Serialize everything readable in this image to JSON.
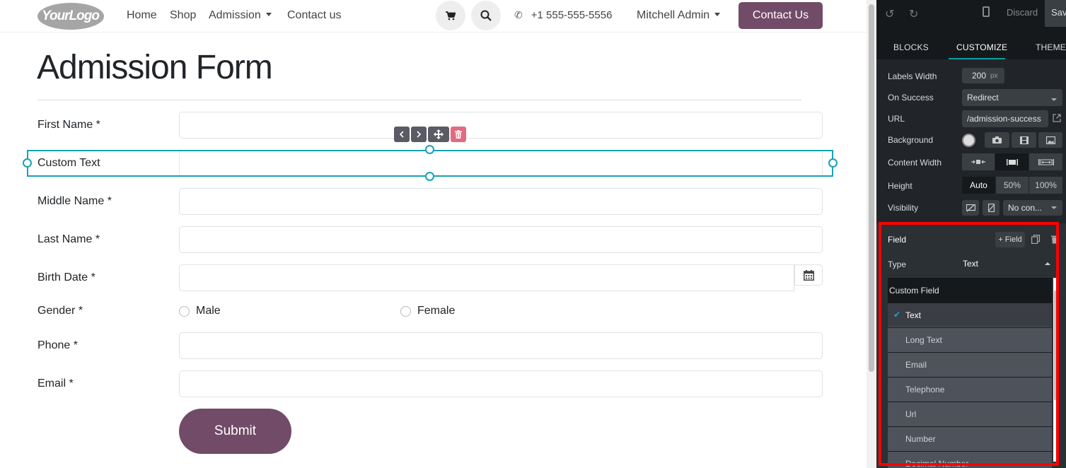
{
  "navbar": {
    "logo_text": "YourLogo",
    "links": [
      "Home",
      "Shop",
      "Admission",
      "Contact us"
    ],
    "cart_icon": "cart-icon",
    "search_icon": "search-icon",
    "phone": "+1 555-555-5556",
    "user": "Mitchell Admin",
    "cta": "Contact Us"
  },
  "form": {
    "title": "Admission Form",
    "fields": {
      "first_name": "First Name *",
      "custom_text": "Custom Text",
      "middle_name": "Middle Name *",
      "last_name": "Last Name *",
      "birth_date": "Birth Date *",
      "gender": "Gender *",
      "phone": "Phone *",
      "email": "Email *"
    },
    "gender_options": [
      "Male",
      "Female"
    ],
    "submit": "Submit"
  },
  "editor": {
    "discard": "Discard",
    "save": "Save",
    "tabs": [
      "BLOCKS",
      "CUSTOMIZE",
      "THEME"
    ],
    "active_tab": "CUSTOMIZE",
    "options": {
      "labels_width_label": "Labels Width",
      "labels_width_value": "200",
      "labels_width_unit": "px",
      "on_success_label": "On Success",
      "on_success_value": "Redirect",
      "url_label": "URL",
      "url_value": "/admission-success",
      "background_label": "Background",
      "content_width_label": "Content Width",
      "height_label": "Height",
      "height_options": [
        "Auto",
        "50%",
        "100%"
      ],
      "visibility_label": "Visibility",
      "visibility_value": "No con..."
    },
    "field": {
      "title": "Field",
      "add_button": "+ Field",
      "type_label": "Type",
      "type_value": "Text"
    },
    "dropdown": {
      "header": "Custom Field",
      "items": [
        "Text",
        "Long Text",
        "Email",
        "Telephone",
        "Url",
        "Number",
        "Decimal Number"
      ],
      "selected": "Text"
    }
  },
  "colors": {
    "brand": "#714b67",
    "selection": "#17a2b8",
    "panel_bg": "#212529",
    "highlight": "#ff0000"
  }
}
